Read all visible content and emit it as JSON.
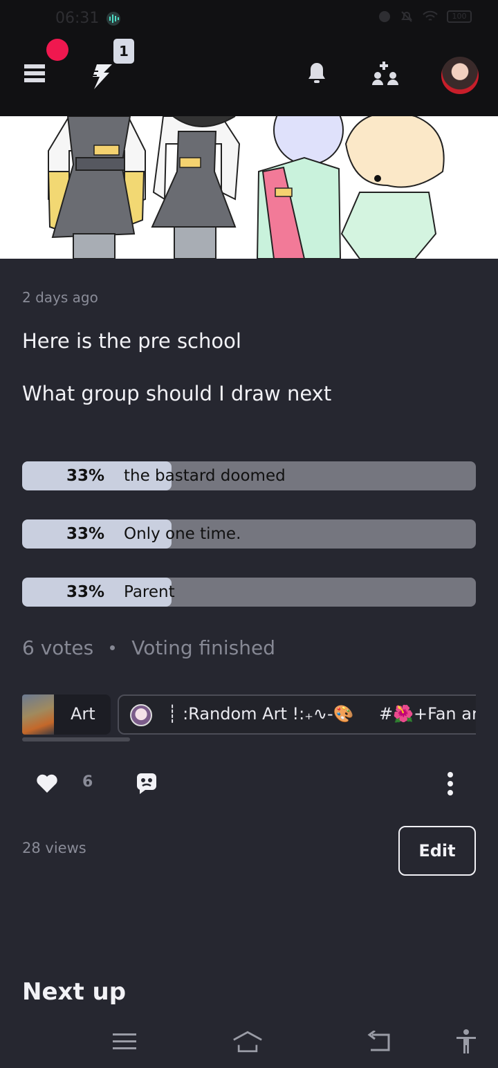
{
  "status_bar": {
    "time": "06:31",
    "battery": "100"
  },
  "header": {
    "bolt_badge": "1"
  },
  "post": {
    "time_ago": "2 days ago",
    "body_lines": [
      "Here is the pre school",
      "What group should I draw next"
    ]
  },
  "poll": {
    "options": [
      {
        "percent": "33%",
        "fraction": 0.33,
        "text": "the bastard doomed"
      },
      {
        "percent": "33%",
        "fraction": 0.33,
        "text": "Only one time."
      },
      {
        "percent": "33%",
        "fraction": 0.33,
        "text": "Parent"
      }
    ],
    "votes": "6 votes",
    "status": "Voting finished"
  },
  "tags": {
    "category": "Art",
    "chat_name": "┊ :Random Art !:₊∿-🎨",
    "hashtag": "#🌺+Fan ar"
  },
  "actions": {
    "like_count": "6",
    "views": "28 views",
    "edit_label": "Edit"
  },
  "next_up": "Next up",
  "colors": {
    "background": "#262730",
    "header": "#111113",
    "poll_fill": "#c9cfdf",
    "poll_track": "#75767f",
    "notification_dot": "#f0184f"
  }
}
